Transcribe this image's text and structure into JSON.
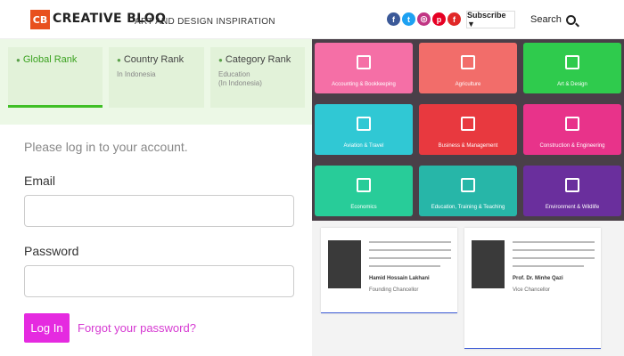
{
  "header": {
    "logo_mark": "CB",
    "logo_text": "CREATIVE BLOQ",
    "tagline": "ART AND DESIGN INSPIRATION",
    "socials": [
      {
        "name": "facebook",
        "glyph": "f",
        "color": "#3b5998"
      },
      {
        "name": "twitter",
        "glyph": "t",
        "color": "#1da1f2"
      },
      {
        "name": "instagram",
        "glyph": "◎",
        "color": "#c13584"
      },
      {
        "name": "pinterest",
        "glyph": "p",
        "color": "#e60023"
      },
      {
        "name": "flipboard",
        "glyph": "f",
        "color": "#e12828"
      }
    ],
    "subscribe_label": "Subscribe ▼",
    "search_label": "Search"
  },
  "ranks": [
    {
      "label": "Global Rank",
      "sub": ""
    },
    {
      "label": "Country Rank",
      "sub": "In Indonesia"
    },
    {
      "label": "Category Rank",
      "sub": "Education\n(In Indonesia)"
    }
  ],
  "login": {
    "prompt": "Please log in to your account.",
    "email_label": "Email",
    "password_label": "Password",
    "submit_label": "Log In",
    "forgot_label": "Forgot your password?"
  },
  "tiles": [
    {
      "label": "Accounting & Bookkeeping",
      "color": "#f56fa6"
    },
    {
      "label": "Agriculture",
      "color": "#f26d6a"
    },
    {
      "label": "Art & Design",
      "color": "#2fcb4d"
    },
    {
      "label": "Aviation & Travel",
      "color": "#30c8d4"
    },
    {
      "label": "Business & Management",
      "color": "#e8393f"
    },
    {
      "label": "Construction & Engineering",
      "color": "#e8338a"
    },
    {
      "label": "Economics",
      "color": "#28cc99"
    },
    {
      "label": "Education, Training & Teaching",
      "color": "#27b6a8"
    },
    {
      "label": "Environment & Wildlife",
      "color": "#6a2f9d"
    }
  ],
  "people": [
    {
      "name": "Hamid Hossain Lakhani",
      "role": "Founding Chancellor"
    },
    {
      "name": "Prof. Dr. Minhe Qazi",
      "role": "Vice Chancellor"
    }
  ]
}
